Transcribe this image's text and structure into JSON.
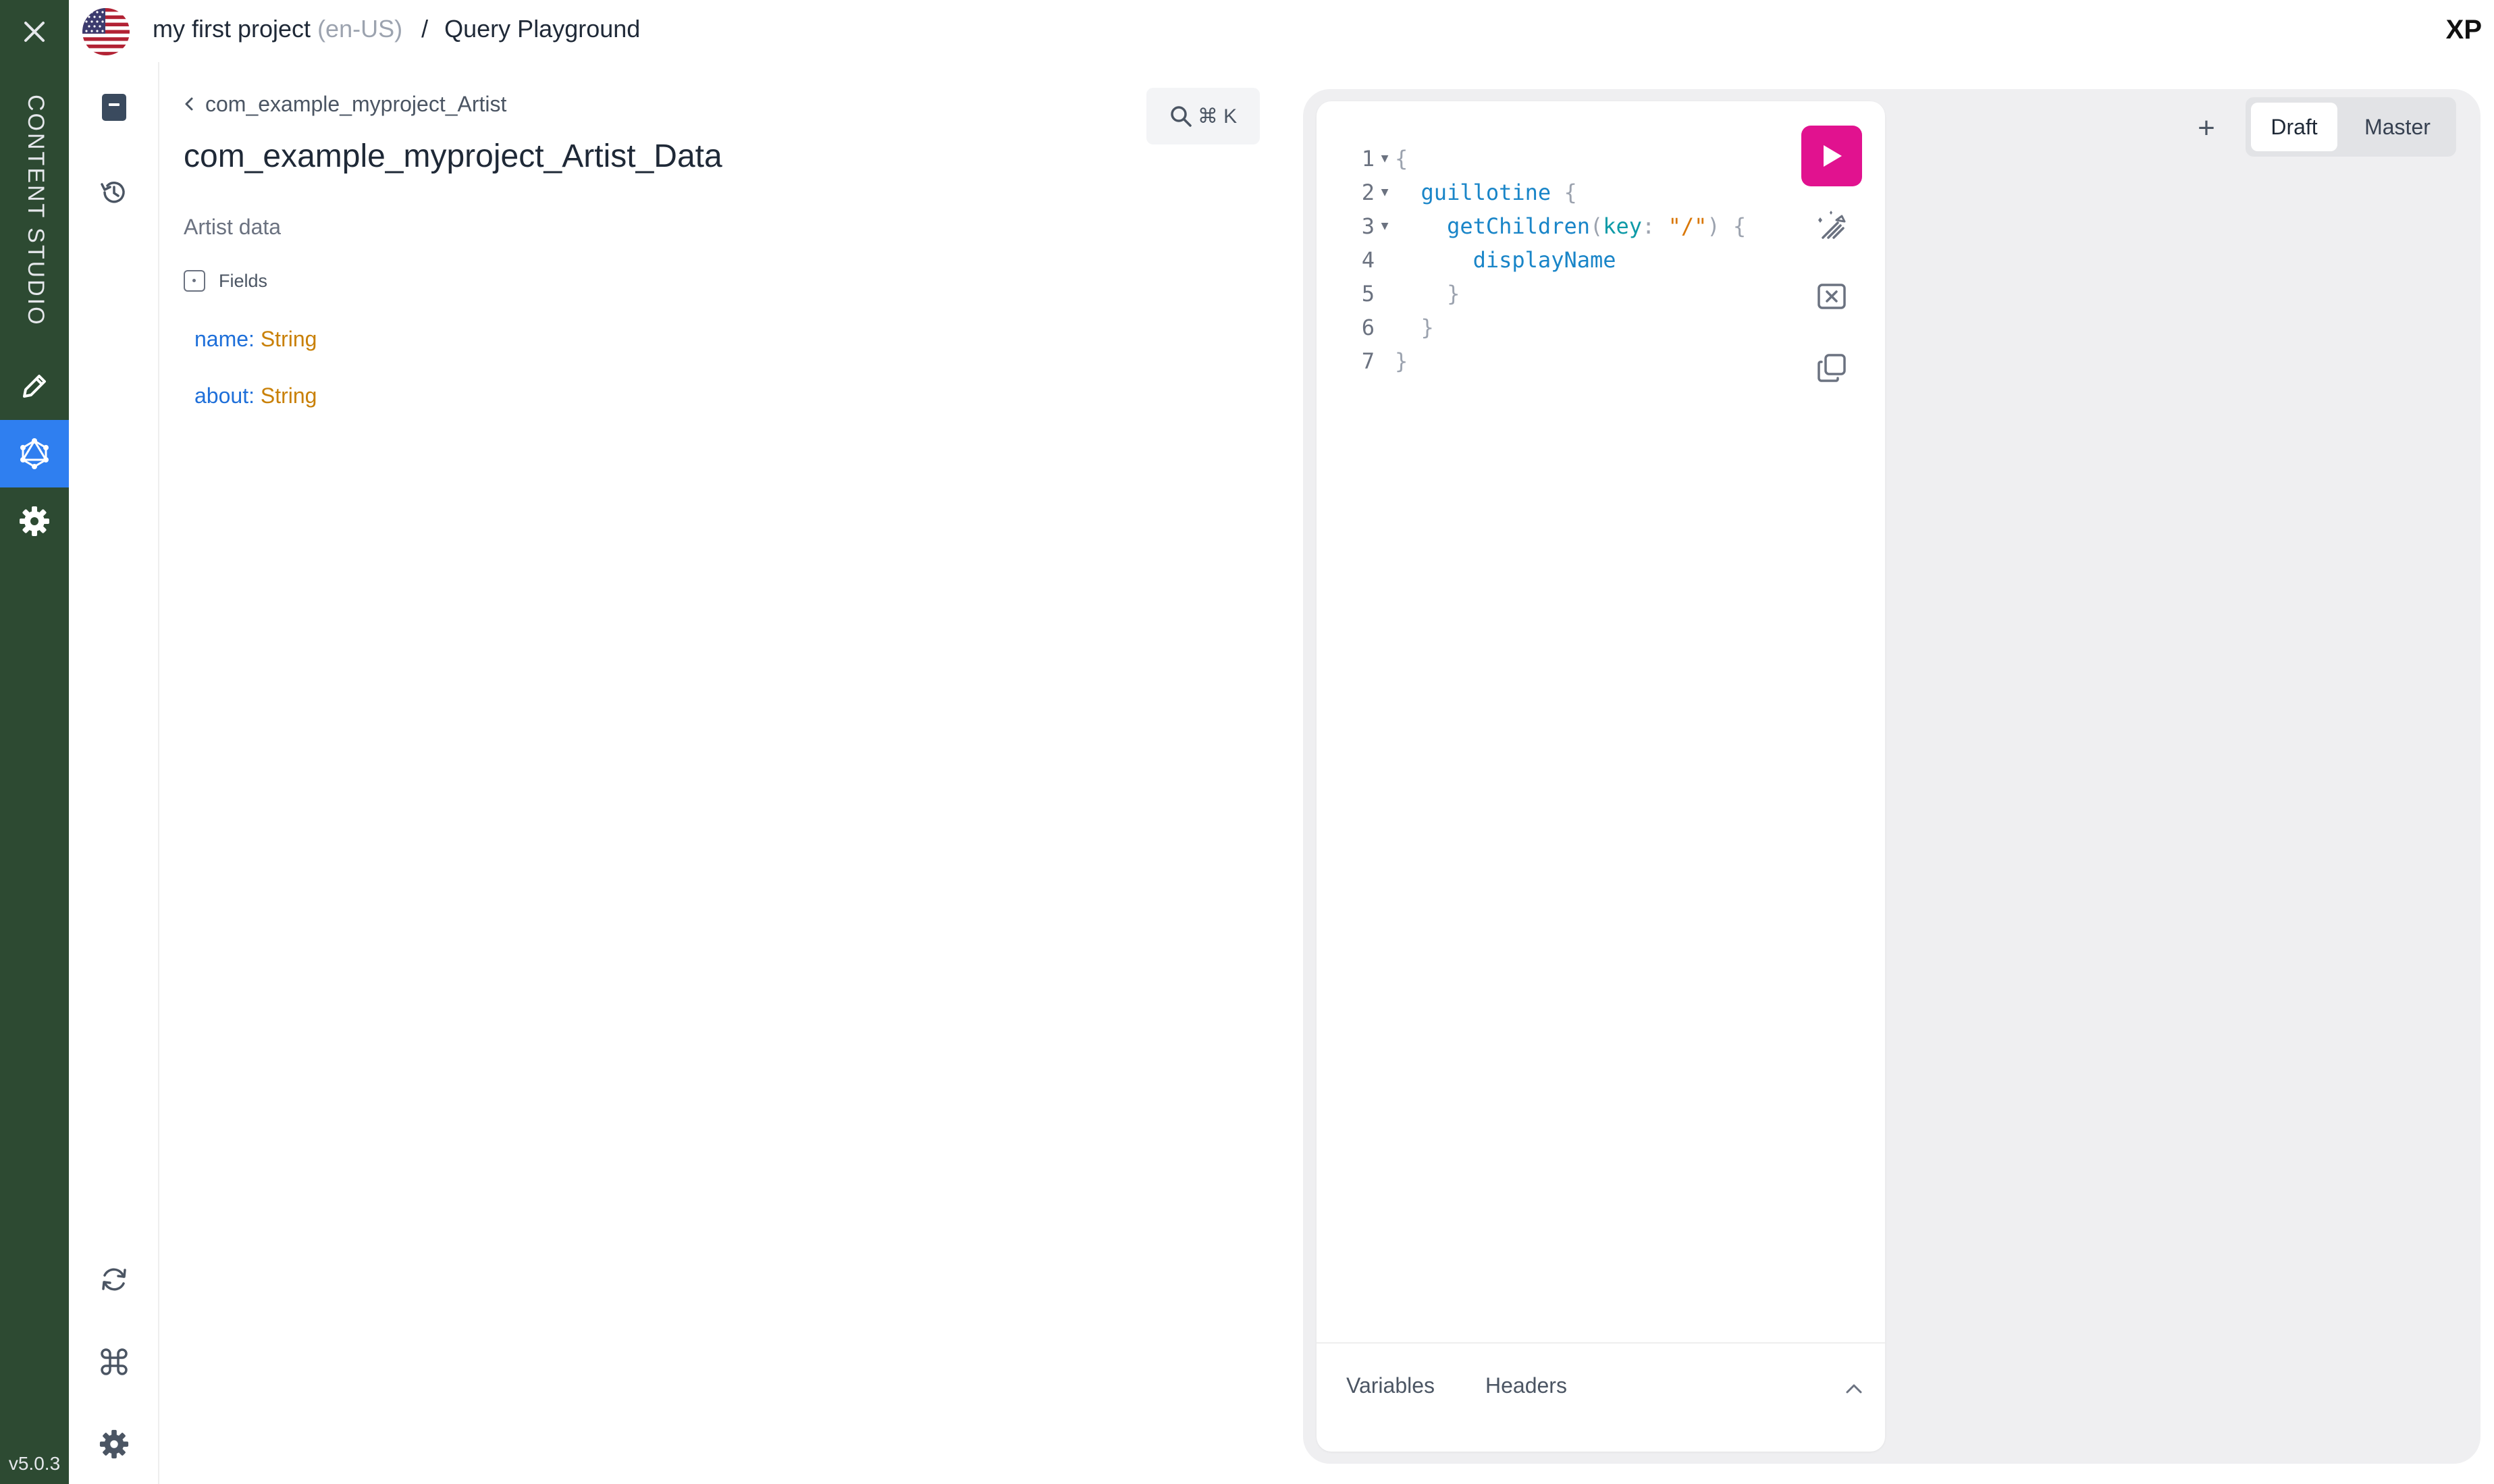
{
  "rail": {
    "title": "CONTENT STUDIO",
    "version": "v5.0.3",
    "items": [
      {
        "name": "rail-item-edit",
        "icon": "pencil-icon",
        "active": false
      },
      {
        "name": "rail-item-graphql",
        "icon": "graphql-icon",
        "active": true
      },
      {
        "name": "rail-item-settings",
        "icon": "gear-icon",
        "active": false
      }
    ],
    "active_color": "#2f7ff0",
    "bg_color": "#2d4a32"
  },
  "topbar": {
    "project": "my first project",
    "language": "(en-US)",
    "separator": "/",
    "page": "Query Playground",
    "logo": "XP"
  },
  "side2": {
    "top_icons": [
      "docs-icon",
      "history-icon"
    ],
    "bottom_icons": [
      "refresh-icon",
      "command-icon",
      "gear-icon"
    ]
  },
  "doc": {
    "back_label": "com_example_myproject_Artist",
    "title": "com_example_myproject_Artist_Data",
    "description": "Artist data",
    "fields_header": "Fields",
    "fields": [
      {
        "name": "name",
        "type": "String"
      },
      {
        "name": "about",
        "type": "String"
      }
    ],
    "search_shortcut": "⌘ K"
  },
  "editor": {
    "lines": [
      {
        "num": "1",
        "fold": true
      },
      {
        "num": "2",
        "fold": true
      },
      {
        "num": "3",
        "fold": true
      },
      {
        "num": "4",
        "fold": false
      },
      {
        "num": "5",
        "fold": false
      },
      {
        "num": "6",
        "fold": false
      },
      {
        "num": "7",
        "fold": false
      }
    ],
    "tokens": {
      "root_field": "guillotine",
      "method": "getChildren",
      "arg_name": "key",
      "arg_value": "\"/\"",
      "sub_field": "displayName"
    },
    "run_color": "#e1128f",
    "footer_tabs": [
      "Variables",
      "Headers"
    ]
  },
  "branches": {
    "options": [
      "Draft",
      "Master"
    ],
    "selected": "Draft",
    "add_label": "+"
  }
}
